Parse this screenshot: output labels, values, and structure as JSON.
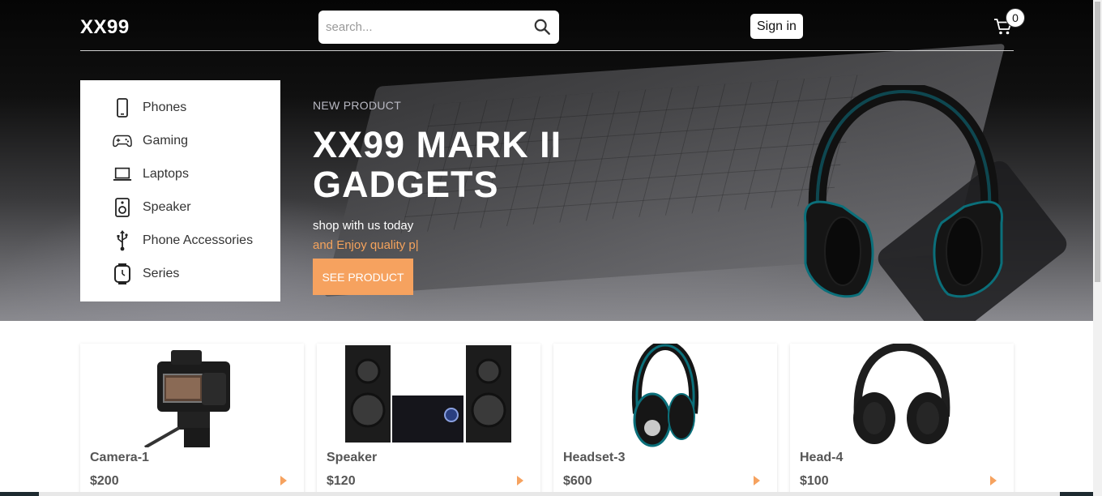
{
  "header": {
    "logo": "XX99",
    "search_placeholder": "search...",
    "signin_label": "Sign in",
    "cart_count": "0"
  },
  "menu": {
    "items": [
      {
        "label": "Phones",
        "icon": "phone-icon"
      },
      {
        "label": "Gaming",
        "icon": "gamepad-icon"
      },
      {
        "label": "Laptops",
        "icon": "laptop-icon"
      },
      {
        "label": "Speaker",
        "icon": "speaker-icon"
      },
      {
        "label": "Phone Accessories",
        "icon": "usb-icon"
      },
      {
        "label": "Series",
        "icon": "watch-icon"
      }
    ]
  },
  "hero": {
    "kicker": "NEW PRODUCT",
    "title_line1": "XX99 MARK II",
    "title_line2": "GADGETS",
    "subtitle": "shop with us today",
    "typing": "and Enjoy quality p|",
    "button_label": "SEE PRODUCT"
  },
  "products": [
    {
      "name": "Camera-1",
      "price": "$200",
      "image": "camera-image"
    },
    {
      "name": "Speaker",
      "price": "$120",
      "image": "speaker-image"
    },
    {
      "name": "Headset-3",
      "price": "$600",
      "image": "headset-image"
    },
    {
      "name": "Head-4",
      "price": "$100",
      "image": "headphones-image"
    }
  ],
  "colors": {
    "accent": "#f6a25f",
    "hero_dark": "#050505",
    "text_muted": "#555555"
  }
}
